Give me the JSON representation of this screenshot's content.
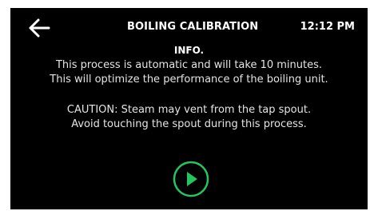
{
  "header": {
    "back_icon": "arrow-left-icon",
    "title": "BOILING CALIBRATION",
    "time": "12:12 PM"
  },
  "info": {
    "heading": "INFO.",
    "line1": "This process is automatic and will take 10 minutes.",
    "line2": "This will optimize the performance of the boiling unit."
  },
  "caution": {
    "line1": "CAUTION: Steam may vent from the tap spout.",
    "line2": "Avoid touching the spout during this process."
  },
  "controls": {
    "start_icon": "play-icon",
    "accent_color": "#22c55e"
  },
  "colors": {
    "background": "#000000",
    "text": "#ffffff"
  }
}
